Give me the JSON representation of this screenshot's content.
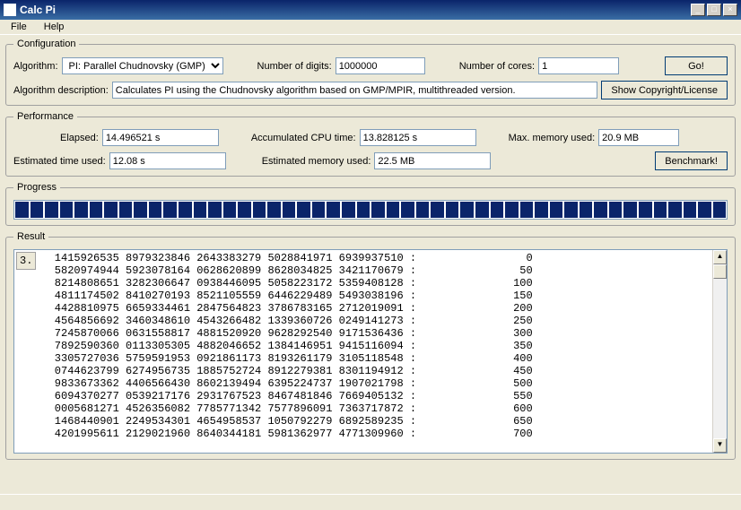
{
  "window": {
    "title": "Calc Pi"
  },
  "menu": {
    "file": "File",
    "help": "Help"
  },
  "config": {
    "legend": "Configuration",
    "algorithm_label": "Algorithm:",
    "algorithm_value": "PI: Parallel Chudnovsky (GMP)",
    "digits_label": "Number of digits:",
    "digits_value": "1000000",
    "cores_label": "Number of cores:",
    "cores_value": "1",
    "go_label": "Go!",
    "desc_label": "Algorithm description:",
    "desc_value": "Calculates PI using the Chudnovsky algorithm based on GMP/MPIR, multithreaded version.",
    "copyright_label": "Show Copyright/License"
  },
  "performance": {
    "legend": "Performance",
    "elapsed_label": "Elapsed:",
    "elapsed_value": "14.496521 s",
    "cpu_label": "Accumulated CPU time:",
    "cpu_value": "13.828125 s",
    "mem_label": "Max. memory used:",
    "mem_value": "20.9 MB",
    "est_time_label": "Estimated time used:",
    "est_time_value": "12.08 s",
    "est_mem_label": "Estimated memory used:",
    "est_mem_value": "22.5 MB",
    "benchmark_label": "Benchmark!"
  },
  "progress": {
    "legend": "Progress"
  },
  "result": {
    "legend": "Result",
    "prefix": "3.",
    "lines": [
      "1415926535 8979323846 2643383279 5028841971 6939937510 :                 0",
      "5820974944 5923078164 0628620899 8628034825 3421170679 :                50",
      "8214808651 3282306647 0938446095 5058223172 5359408128 :               100",
      "4811174502 8410270193 8521105559 6446229489 5493038196 :               150",
      "4428810975 6659334461 2847564823 3786783165 2712019091 :               200",
      "4564856692 3460348610 4543266482 1339360726 0249141273 :               250",
      "7245870066 0631558817 4881520920 9628292540 9171536436 :               300",
      "7892590360 0113305305 4882046652 1384146951 9415116094 :               350",
      "3305727036 5759591953 0921861173 8193261179 3105118548 :               400",
      "0744623799 6274956735 1885752724 8912279381 8301194912 :               450",
      "9833673362 4406566430 8602139494 6395224737 1907021798 :               500",
      "6094370277 0539217176 2931767523 8467481846 7669405132 :               550",
      "0005681271 4526356082 7785771342 7577896091 7363717872 :               600",
      "1468440901 2249534301 4654958537 1050792279 6892589235 :               650",
      "4201995611 2129021960 8640344181 5981362977 4771309960 :               700"
    ]
  }
}
